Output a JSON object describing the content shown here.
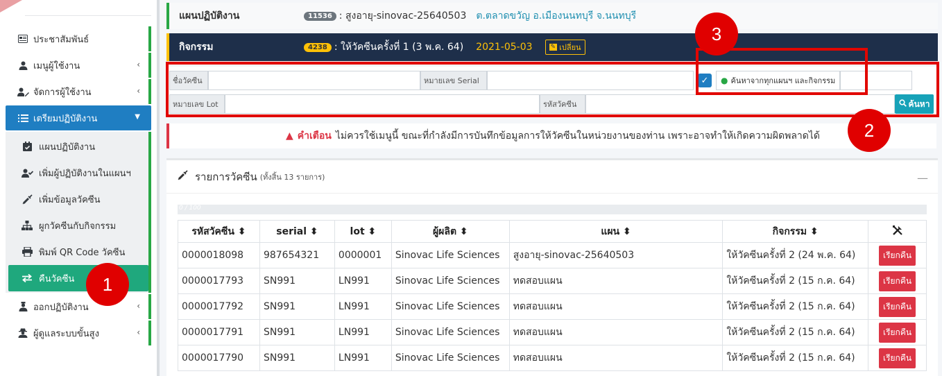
{
  "sidebar": {
    "items_top": [
      {
        "label": "ประชาสัมพันธ์",
        "icon": "newspaper-icon",
        "chevron": false
      },
      {
        "label": "เมนูผู้ใช้งาน",
        "icon": "user-icon",
        "chevron": true
      },
      {
        "label": "จัดการผู้ใช้งาน",
        "icon": "user-edit-icon",
        "chevron": true
      }
    ],
    "active_section": {
      "label": "เตรียมปฏิบัติงาน",
      "icon": "list-icon"
    },
    "sub_items": [
      {
        "label": "แผนปฏิบัติงาน",
        "icon": "calendar-check-icon"
      },
      {
        "label": "เพิ่มผู้ปฏิบัติงานในแผนฯ",
        "icon": "user-check-icon"
      },
      {
        "label": "เพิ่มข้อมูลวัคซีน",
        "icon": "syringe-icon"
      },
      {
        "label": "ผูกวัคซีนกับกิจกรรม",
        "icon": "sitemap-icon"
      },
      {
        "label": "พิมพ์ QR Code วัคซีน",
        "icon": "print-icon"
      },
      {
        "label": "คืนวัคซีน",
        "icon": "exchange-icon"
      }
    ],
    "items_bottom": [
      {
        "label": "ออกปฏิบัติงาน",
        "icon": "user-nurse-icon",
        "chevron": true
      },
      {
        "label": "ผู้ดูแลระบบขั้นสูง",
        "icon": "user-secret-icon",
        "chevron": true
      }
    ]
  },
  "plan": {
    "label": "แผนปฏิบัติงาน",
    "badge": "11536",
    "name": ": สูงอายุ-sinovac-25640503",
    "location": "ต.ตลาดขวัญ อ.เมืองนนทบุรี จ.นนทบุรี"
  },
  "activity": {
    "label": "กิจกรรม",
    "badge": "4238",
    "name": ": ให้วัคซีนครั้งที่ 1 (3 พ.ค. 64)",
    "date": "2021-05-03",
    "change_label": "เปลี่ยน"
  },
  "search": {
    "vaccine_name_label": "ชื่อวัคซีน",
    "serial_label": "หมายเลข Serial",
    "lot_label": "หมายเลข Lot",
    "code_label": "รหัสวัคซีน",
    "search_all_label": "ค้นหาจากทุกแผนฯ และกิจกรรม",
    "search_button": "ค้นหา"
  },
  "warning": {
    "title": "คำเตือน",
    "text": "ไม่ควรใช้เมนูนี้ ขณะที่กำลังมีการบันทึกข้อมูลการให้วัคซีนในหน่วยงานของท่าน เพราะอาจทำให้เกิดความผิดพลาดได้"
  },
  "card": {
    "title": "รายการวัคซีน",
    "count": "(ทั้งสิ้น 13 รายการ)",
    "progress_text": "0 / 100",
    "progress": 0
  },
  "table": {
    "headers": [
      "รหัสวัคซีน ⬍",
      "serial ⬍",
      "lot ⬍",
      "ผู้ผลิต ⬍",
      "แผน ⬍",
      "กิจกรรม ⬍"
    ],
    "return_label": "เรียกคืน",
    "rows": [
      [
        "0000018098",
        "987654321",
        "0000001",
        "Sinovac Life Sciences",
        "สูงอายุ-sinovac-25640503",
        "ให้วัคซีนครั้งที่ 2 (24 พ.ค. 64)"
      ],
      [
        "0000017793",
        "SN991",
        "LN991",
        "Sinovac Life Sciences",
        "ทดสอบแผน",
        "ให้วัคซีนครั้งที่ 2 (15 ก.ค. 64)"
      ],
      [
        "0000017792",
        "SN991",
        "LN991",
        "Sinovac Life Sciences",
        "ทดสอบแผน",
        "ให้วัคซีนครั้งที่ 2 (15 ก.ค. 64)"
      ],
      [
        "0000017791",
        "SN991",
        "LN991",
        "Sinovac Life Sciences",
        "ทดสอบแผน",
        "ให้วัคซีนครั้งที่ 2 (15 ก.ค. 64)"
      ],
      [
        "0000017790",
        "SN991",
        "LN991",
        "Sinovac Life Sciences",
        "ทดสอบแผน",
        "ให้วัคซีนครั้งที่ 2 (15 ก.ค. 64)"
      ]
    ]
  },
  "annotations": [
    "1",
    "2",
    "3"
  ],
  "colors": {
    "annotation_red": "#e00000",
    "active_blue": "#1f7ec2",
    "active_green": "#1fa87d",
    "header_dark": "#1e2f4a"
  }
}
